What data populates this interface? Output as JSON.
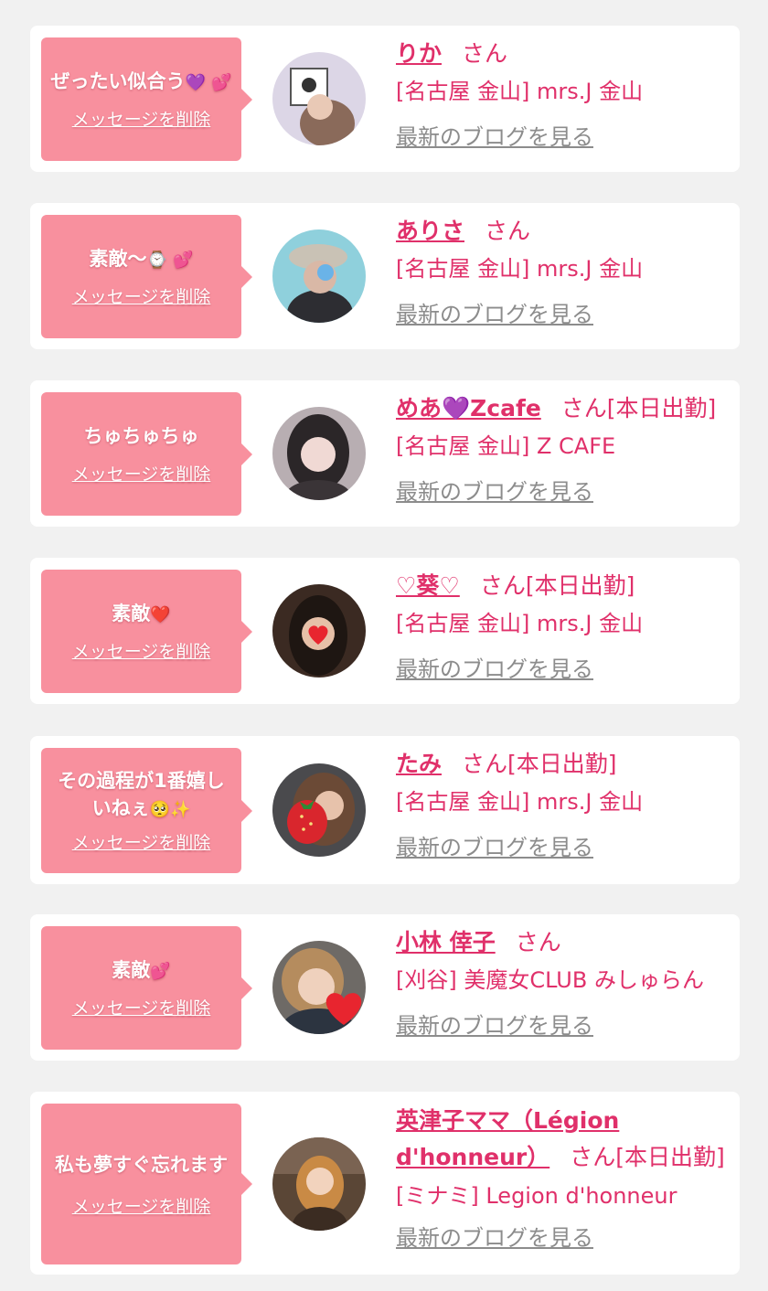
{
  "colors": {
    "accent": "#e0306a",
    "bubble": "#f8909e",
    "link_gray": "#8c8c8c",
    "background": "#f1f1f1"
  },
  "messages": [
    {
      "text": "ぜったい似合う",
      "emoji": "💜 💕",
      "delete_label": "メッセージを削除",
      "name": "りか",
      "honorific": "さん",
      "status": "",
      "shop": "[名古屋 金山] mrs.J 金山",
      "blog_link": "最新のブログを見る"
    },
    {
      "text": "素敵〜",
      "emoji": "⌚ 💕",
      "delete_label": "メッセージを削除",
      "name": "ありさ",
      "honorific": "さん",
      "status": "",
      "shop": "[名古屋 金山] mrs.J 金山",
      "blog_link": "最新のブログを見る"
    },
    {
      "text": "ちゅちゅちゅ",
      "emoji": "",
      "delete_label": "メッセージを削除",
      "name": "めあ💜Zcafe",
      "honorific": "さん",
      "status": "[本日出勤]",
      "shop": "[名古屋 金山] Z CAFE",
      "blog_link": "最新のブログを見る"
    },
    {
      "text": "素敵",
      "emoji": "❤️",
      "delete_label": "メッセージを削除",
      "name": "♡葵♡",
      "honorific": "さん",
      "status": "[本日出勤]",
      "shop": "[名古屋 金山] mrs.J 金山",
      "blog_link": "最新のブログを見る"
    },
    {
      "text": "その過程が1番嬉しいねぇ",
      "emoji": "🥺✨",
      "delete_label": "メッセージを削除",
      "name": "たみ",
      "honorific": "さん",
      "status": "[本日出勤]",
      "shop": "[名古屋 金山] mrs.J 金山",
      "blog_link": "最新のブログを見る"
    },
    {
      "text": "素敵",
      "emoji": "💕",
      "delete_label": "メッセージを削除",
      "name": "小林 倖子",
      "honorific": "さん",
      "status": "",
      "shop": "[刈谷] 美魔女CLUB みしゅらん",
      "blog_link": "最新のブログを見る"
    },
    {
      "text": "私も夢すぐ忘れます",
      "emoji": "",
      "delete_label": "メッセージを削除",
      "name": "英津子ママ（Légion d'honneur）",
      "honorific": "さん",
      "status": "[本日出勤]",
      "shop": "[ミナミ] Legion d'honneur",
      "blog_link": "最新のブログを見る"
    }
  ]
}
